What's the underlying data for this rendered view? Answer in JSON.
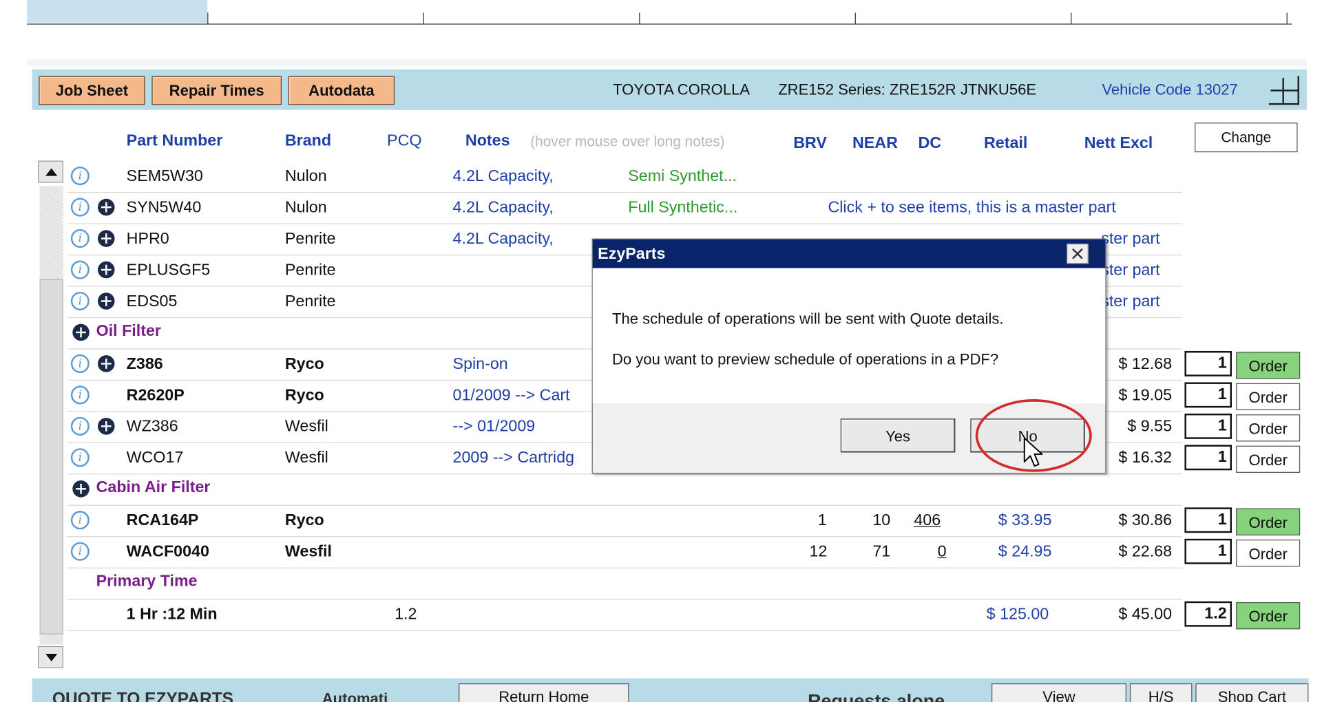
{
  "toolbar": {
    "job_sheet": "Job Sheet",
    "repair_times": "Repair Times",
    "autodata": "Autodata",
    "vehicle_model": "TOYOTA COROLLA",
    "vehicle_series": "ZRE152 Series: ZRE152R JTNKU56E",
    "vehicle_code": "Vehicle Code 13027"
  },
  "columns": {
    "part_number": "Part Number",
    "brand": "Brand",
    "pcq": "PCQ",
    "notes": "Notes",
    "notes_hint": "(hover mouse over long notes)",
    "brv": "BRV",
    "near": "NEAR",
    "dc": "DC",
    "retail": "Retail",
    "nett_excl": "Nett Excl",
    "change": "Change"
  },
  "rows": [
    {
      "part": "SEM5W30",
      "brand": "Nulon",
      "note1": "4.2L Capacity,",
      "note2": "Semi Synthet..."
    },
    {
      "part": "SYN5W40",
      "brand": "Nulon",
      "note1": "4.2L Capacity,",
      "note2": "Full Synthetic...",
      "master": "Click + to see items, this is a master part"
    },
    {
      "part": "HPR0",
      "brand": "Penrite",
      "note1": "4.2L Capacity,",
      "master_tail": "ster part"
    },
    {
      "part": "EPLUSGF5",
      "brand": "Penrite",
      "master_tail": "ster part"
    },
    {
      "part": "EDS05",
      "brand": "Penrite",
      "master_tail": "ster part"
    },
    {
      "category": "Oil Filter"
    },
    {
      "part": "Z386",
      "brand": "Ryco",
      "note1": "Spin-on",
      "nett": "$ 12.68",
      "qty": "1",
      "order": "Order"
    },
    {
      "part": "R2620P",
      "brand": "Ryco",
      "note1": "01/2009 --> Cart",
      "nett": "$ 19.05",
      "qty": "1",
      "order": "Order"
    },
    {
      "part": "WZ386",
      "brand": "Wesfil",
      "note1": "--> 01/2009",
      "nett": "$ 9.55",
      "qty": "1",
      "order": "Order"
    },
    {
      "part": "WCO17",
      "brand": "Wesfil",
      "note1": "2009 --> Cartridg",
      "nett": "$ 16.32",
      "qty": "1",
      "order": "Order"
    },
    {
      "category": "Cabin Air Filter"
    },
    {
      "part": "RCA164P",
      "brand": "Ryco",
      "brv": "1",
      "near": "10",
      "dc": "406",
      "retail": "$ 33.95",
      "nett": "$ 30.86",
      "qty": "1",
      "order": "Order"
    },
    {
      "part": "WACF0040",
      "brand": "Wesfil",
      "brv": "12",
      "near": "71",
      "dc": "0",
      "retail": "$ 24.95",
      "nett": "$ 22.68",
      "qty": "1",
      "order": "Order"
    },
    {
      "category": "Primary Time"
    },
    {
      "part": "1 Hr :12 Min",
      "pcq": "1.2",
      "retail": "$ 125.00",
      "nett": "$ 45.00",
      "qty": "1.2",
      "order": "Order"
    }
  ],
  "dialog": {
    "title": "EzyParts",
    "line1": "The schedule of operations will be sent with Quote details.",
    "line2": "Do you want to preview schedule of operations in a PDF?",
    "yes": "Yes",
    "no": "No"
  },
  "bottom": {
    "left_text": "QUOTE TO EZYPARTS",
    "check_label": "Automati",
    "button1": "Return Home",
    "requests": "Requests alone",
    "view": "View",
    "hs": "H/S",
    "shop_cart": "Shop Cart"
  },
  "colors": {
    "toolbar_bg": "#b8dbe8",
    "button_orange": "#f4b98b",
    "header_blue": "#1f3fa8",
    "note_green": "#2f9a2f",
    "category_purple": "#7a1f8a",
    "order_green": "#86d27d",
    "dialog_title": "#0a246a",
    "highlight_red": "#d62b2b"
  }
}
